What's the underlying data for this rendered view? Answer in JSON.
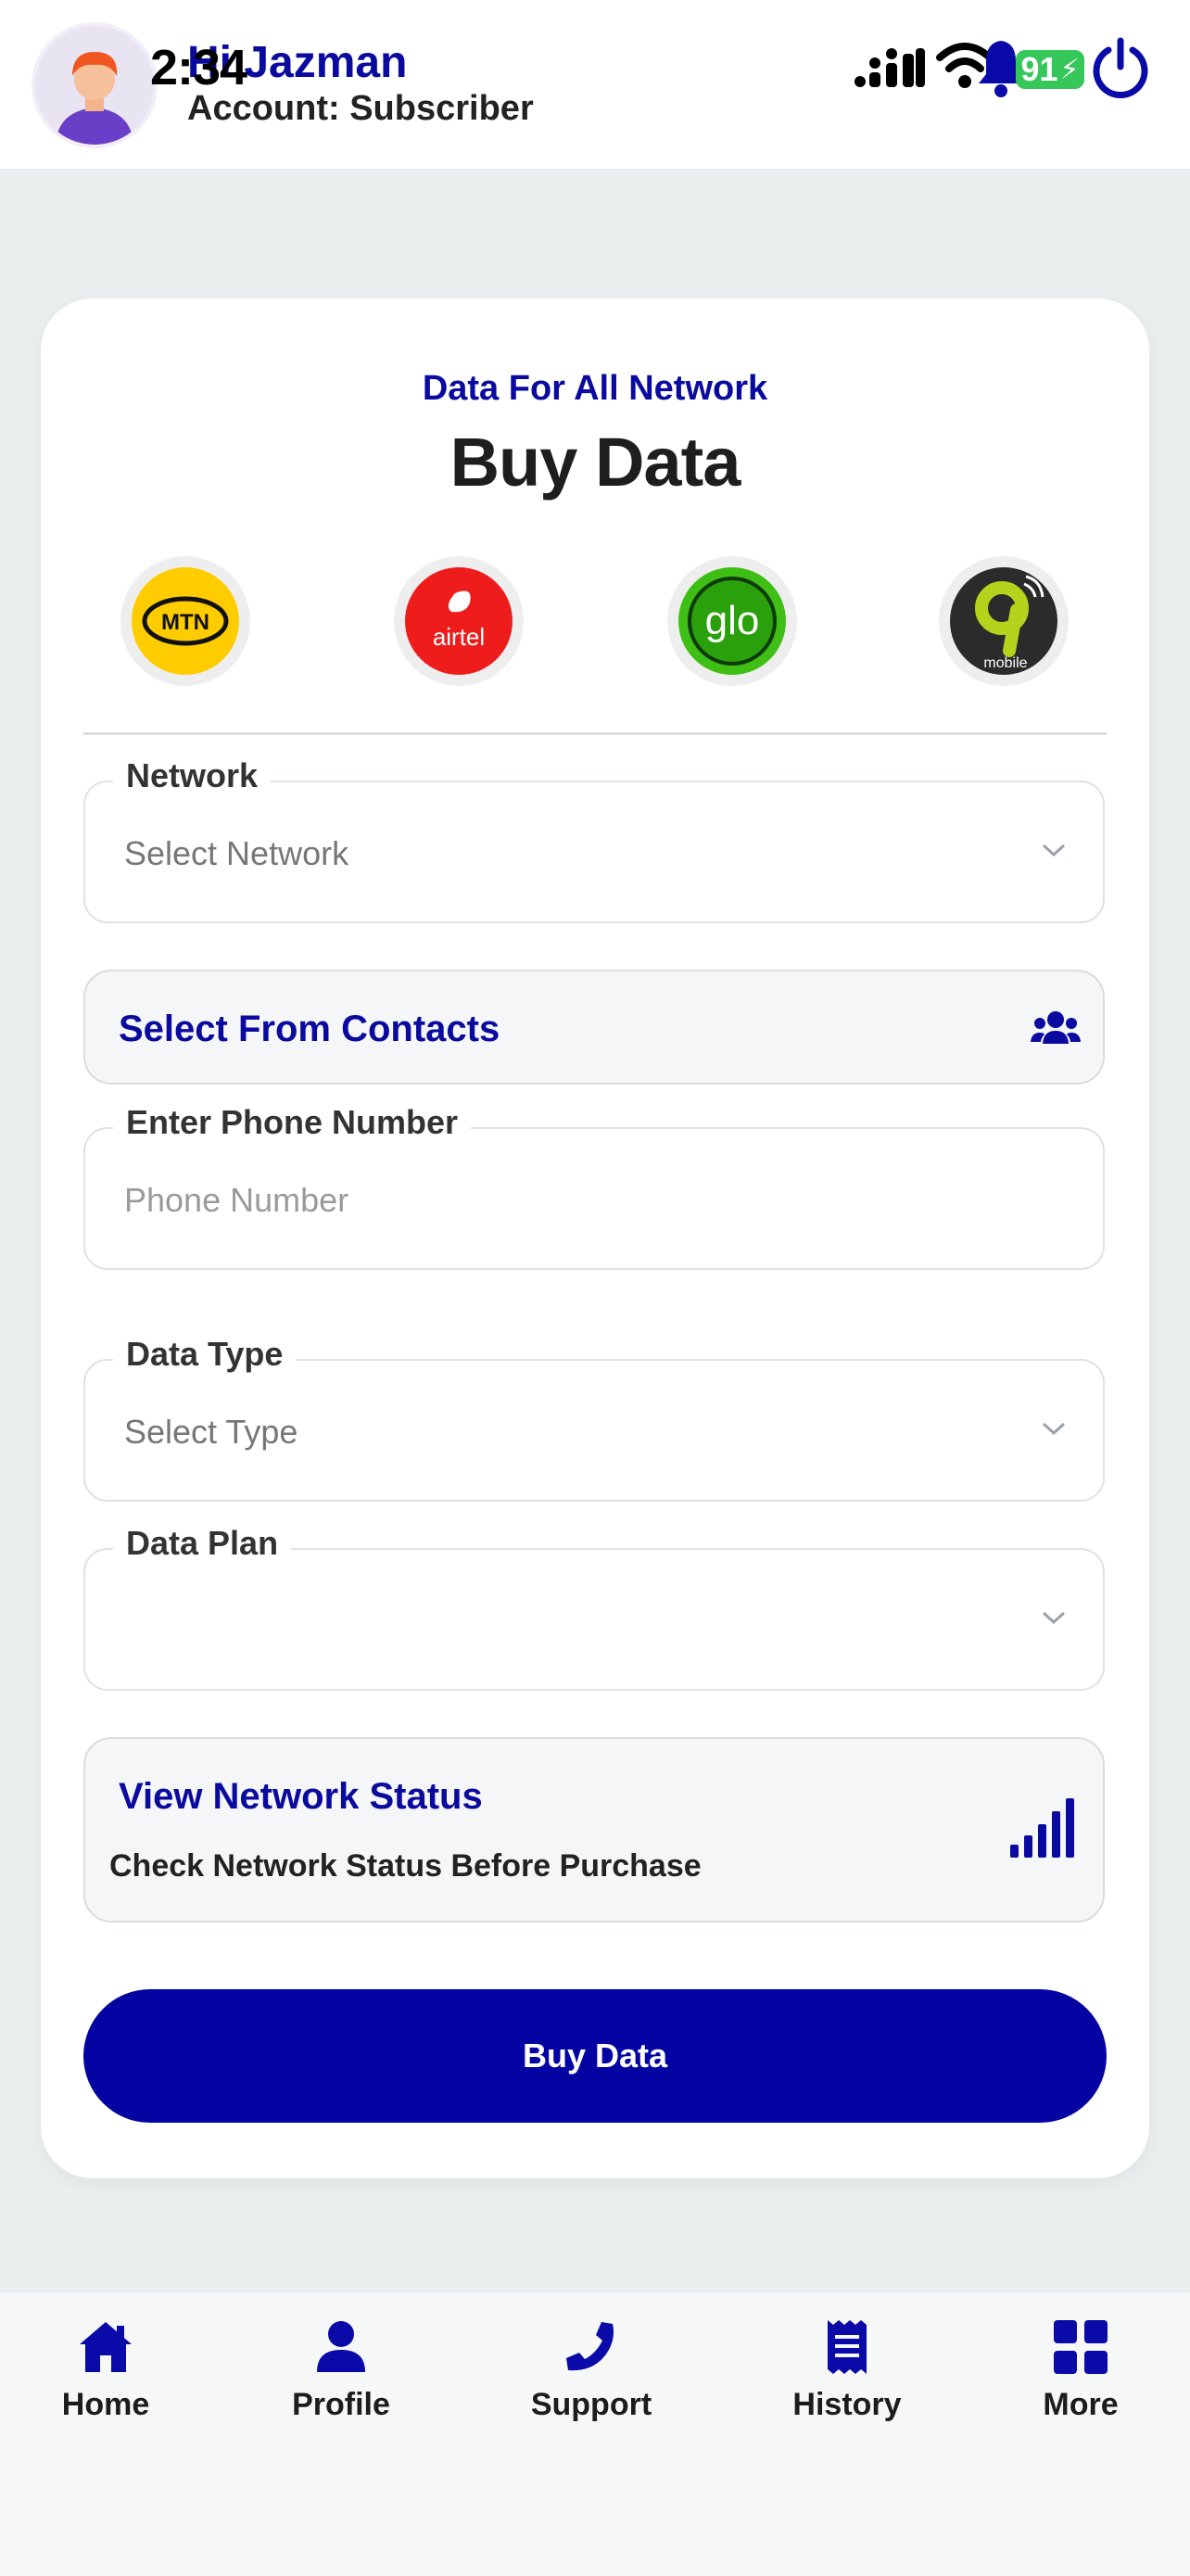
{
  "status_bar": {
    "time": "2:34",
    "battery": "91"
  },
  "header": {
    "greeting": "Hi Jazman",
    "account": "Account: Subscriber"
  },
  "page": {
    "subtitle": "Data For All Network",
    "title": "Buy Data"
  },
  "networks": [
    {
      "name": "MTN",
      "text": "MTN",
      "color": "#ffcc00"
    },
    {
      "name": "airtel",
      "text": "airtel",
      "color": "#ef1c1c"
    },
    {
      "name": "glo",
      "text": "glo",
      "color": "#3fbf15"
    },
    {
      "name": "9mobile",
      "text": "mobile",
      "color": "#2b2b2b"
    }
  ],
  "form": {
    "network": {
      "label": "Network",
      "value": "Select Network"
    },
    "contacts": {
      "label": "Select From Contacts"
    },
    "phone": {
      "label": "Enter Phone Number",
      "placeholder": "Phone Number"
    },
    "data_type": {
      "label": "Data Type",
      "value": "Select Type"
    },
    "data_plan": {
      "label": "Data Plan",
      "value": ""
    }
  },
  "network_status": {
    "title": "View Network Status",
    "description": "Check Network Status Before Purchase"
  },
  "buy_button": "Buy Data",
  "bottom_nav": [
    {
      "label": "Home",
      "icon": "home-icon"
    },
    {
      "label": "Profile",
      "icon": "user-icon"
    },
    {
      "label": "Support",
      "icon": "phone-icon"
    },
    {
      "label": "History",
      "icon": "receipt-icon"
    },
    {
      "label": "More",
      "icon": "grid-icon"
    }
  ],
  "colors": {
    "brand": "#0404a3",
    "accent_text": "#0a0a9e",
    "battery": "#35c759"
  }
}
